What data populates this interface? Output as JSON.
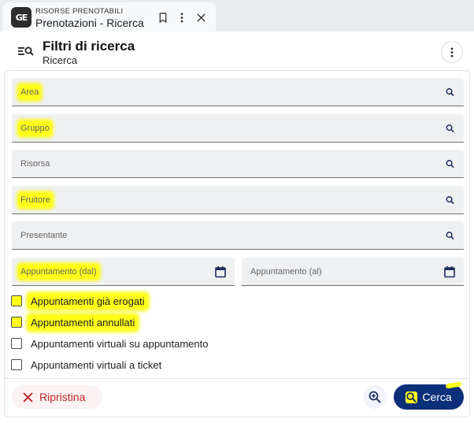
{
  "tab": {
    "app_name": "RISORSE PRENOTABILI",
    "title": "Prenotazioni - Ricerca",
    "logo_text": "GE"
  },
  "header": {
    "title": "Filtri di ricerca",
    "subtitle": "Ricerca"
  },
  "filters": {
    "area": {
      "placeholder": "Area"
    },
    "gruppo": {
      "placeholder": "Gruppo"
    },
    "risorsa": {
      "placeholder": "Risorsa"
    },
    "fruitore": {
      "placeholder": "Fruitore"
    },
    "presentante": {
      "placeholder": "Presentante"
    },
    "appuntamento_dal": {
      "placeholder": "Appuntamento (dal)"
    },
    "appuntamento_al": {
      "placeholder": "Appuntamento (al)"
    }
  },
  "checkboxes": [
    {
      "label": "Appuntamenti già erogati",
      "checked": false
    },
    {
      "label": "Appuntamenti annullati",
      "checked": false
    },
    {
      "label": "Appuntamenti virtuali su appuntamento",
      "checked": false
    },
    {
      "label": "Appuntamenti virtuali a ticket",
      "checked": false
    }
  ],
  "actions": {
    "reset_label": "Ripristina",
    "search_label": "Cerca"
  },
  "colors": {
    "primary": "#0c2f7a",
    "danger": "#c0262b",
    "highlight": "#ffff1a"
  },
  "icons": {
    "tab_bookmark": "bookmark-icon",
    "tab_menu": "more-vert-icon",
    "tab_close": "close-icon",
    "header": "filter-search-icon",
    "field_search": "search-icon",
    "field_date": "calendar-icon",
    "reset": "close-icon",
    "zoom": "zoom-in-icon",
    "search": "search-icon"
  }
}
